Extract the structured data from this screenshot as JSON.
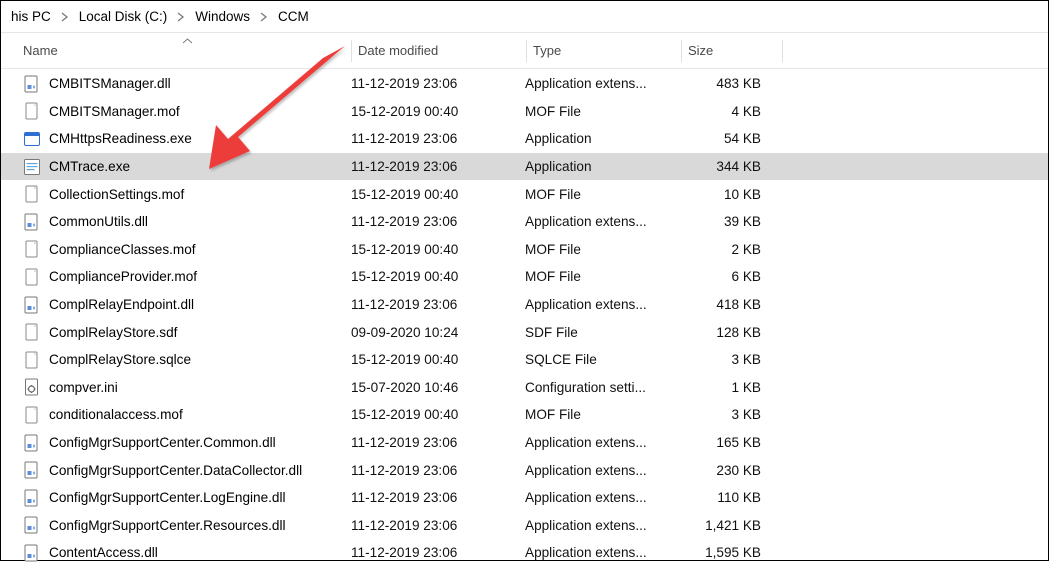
{
  "breadcrumb": [
    {
      "label": "his PC"
    },
    {
      "label": "Local Disk (C:)"
    },
    {
      "label": "Windows"
    },
    {
      "label": "CCM"
    }
  ],
  "columns": {
    "name": "Name",
    "date": "Date modified",
    "type": "Type",
    "size": "Size"
  },
  "icons": {
    "dll": "dll-file-icon",
    "mof": "mof-file-icon",
    "exe_http": "exe-blue-icon",
    "exe_cmtrace": "exe-cmtrace-icon",
    "generic": "generic-file-icon",
    "ini": "ini-file-icon"
  },
  "colors": {
    "selected_bg": "#d9d9d9",
    "arrow_red": "#ed3e3b"
  },
  "files": [
    {
      "icon": "dll",
      "name": "CMBITSManager.dll",
      "date": "11-12-2019 23:06",
      "type": "Application extens...",
      "size": "483 KB"
    },
    {
      "icon": "generic",
      "name": "CMBITSManager.mof",
      "date": "15-12-2019 00:40",
      "type": "MOF File",
      "size": "4 KB"
    },
    {
      "icon": "exe_http",
      "name": "CMHttpsReadiness.exe",
      "date": "11-12-2019 23:06",
      "type": "Application",
      "size": "54 KB"
    },
    {
      "icon": "exe_cmtrace",
      "name": "CMTrace.exe",
      "date": "11-12-2019 23:06",
      "type": "Application",
      "size": "344 KB",
      "selected": true
    },
    {
      "icon": "generic",
      "name": "CollectionSettings.mof",
      "date": "15-12-2019 00:40",
      "type": "MOF File",
      "size": "10 KB"
    },
    {
      "icon": "dll",
      "name": "CommonUtils.dll",
      "date": "11-12-2019 23:06",
      "type": "Application extens...",
      "size": "39 KB"
    },
    {
      "icon": "generic",
      "name": "ComplianceClasses.mof",
      "date": "15-12-2019 00:40",
      "type": "MOF File",
      "size": "2 KB"
    },
    {
      "icon": "generic",
      "name": "ComplianceProvider.mof",
      "date": "15-12-2019 00:40",
      "type": "MOF File",
      "size": "6 KB"
    },
    {
      "icon": "dll",
      "name": "ComplRelayEndpoint.dll",
      "date": "11-12-2019 23:06",
      "type": "Application extens...",
      "size": "418 KB"
    },
    {
      "icon": "generic",
      "name": "ComplRelayStore.sdf",
      "date": "09-09-2020 10:24",
      "type": "SDF File",
      "size": "128 KB"
    },
    {
      "icon": "generic",
      "name": "ComplRelayStore.sqlce",
      "date": "15-12-2019 00:40",
      "type": "SQLCE File",
      "size": "3 KB"
    },
    {
      "icon": "ini",
      "name": "compver.ini",
      "date": "15-07-2020 10:46",
      "type": "Configuration setti...",
      "size": "1 KB"
    },
    {
      "icon": "generic",
      "name": "conditionalaccess.mof",
      "date": "15-12-2019 00:40",
      "type": "MOF File",
      "size": "3 KB"
    },
    {
      "icon": "dll",
      "name": "ConfigMgrSupportCenter.Common.dll",
      "date": "11-12-2019 23:06",
      "type": "Application extens...",
      "size": "165 KB"
    },
    {
      "icon": "dll",
      "name": "ConfigMgrSupportCenter.DataCollector.dll",
      "date": "11-12-2019 23:06",
      "type": "Application extens...",
      "size": "230 KB"
    },
    {
      "icon": "dll",
      "name": "ConfigMgrSupportCenter.LogEngine.dll",
      "date": "11-12-2019 23:06",
      "type": "Application extens...",
      "size": "110 KB"
    },
    {
      "icon": "dll",
      "name": "ConfigMgrSupportCenter.Resources.dll",
      "date": "11-12-2019 23:06",
      "type": "Application extens...",
      "size": "1,421 KB"
    },
    {
      "icon": "dll",
      "name": "ContentAccess.dll",
      "date": "11-12-2019 23:06",
      "type": "Application extens...",
      "size": "1,595 KB"
    }
  ]
}
